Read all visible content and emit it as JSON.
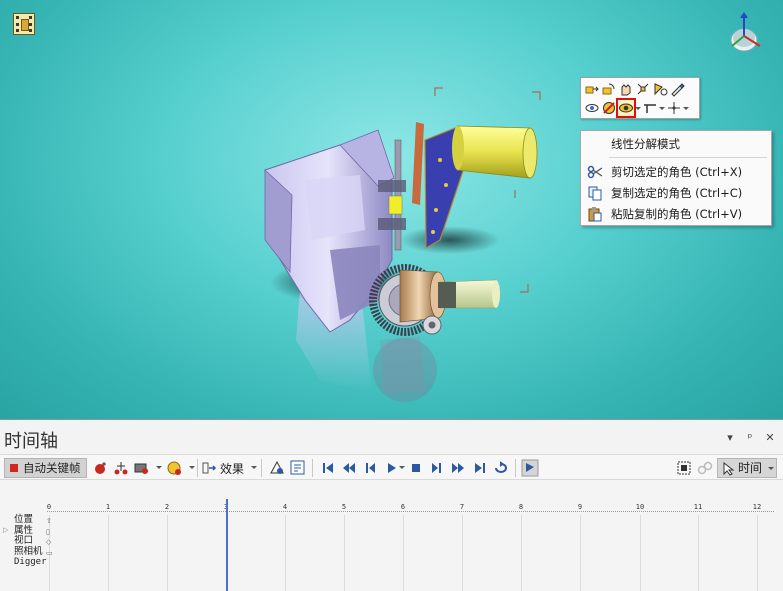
{
  "timeline": {
    "title": "时间轴",
    "autokey_label": "自动关键帧",
    "effects_label": "效果",
    "time_mode_label": "时间",
    "ruler_ticks": [
      "0",
      "1",
      "2",
      "3",
      "4",
      "5",
      "6",
      "7",
      "8",
      "9",
      "10",
      "11",
      "12"
    ],
    "tracks": [
      "位置",
      "属性",
      "视口",
      "照相机"
    ],
    "root_node": "Digger",
    "panel_controls": [
      "▾",
      "ᵖ",
      "✕"
    ]
  },
  "context_menu": {
    "items": [
      {
        "label": "线性分解模式",
        "icon": ""
      },
      {
        "label": "剪切选定的角色 (Ctrl+X)",
        "icon": "scissors-icon"
      },
      {
        "label": "复制选定的角色 (Ctrl+C)",
        "icon": "copy-icon"
      },
      {
        "label": "粘贴复制的角色 (Ctrl+V)",
        "icon": "paste-icon"
      }
    ]
  },
  "mini_toolbar": {
    "row1": [
      "translate-icon",
      "rotate-icon",
      "hand-icon",
      "explode-icon",
      "select-icon",
      "pen-icon"
    ],
    "row2": [
      "visibility-icon",
      "hide-icon",
      "eye-show-icon",
      "line-tool-icon",
      "pivot-icon"
    ],
    "selected": "eye-show-icon",
    "highlight_color": "#e01010"
  },
  "colors": {
    "viewport_bg": "#57d0cf",
    "autokey_dot": "#d0281e",
    "playhead": "#4a6fd0"
  }
}
